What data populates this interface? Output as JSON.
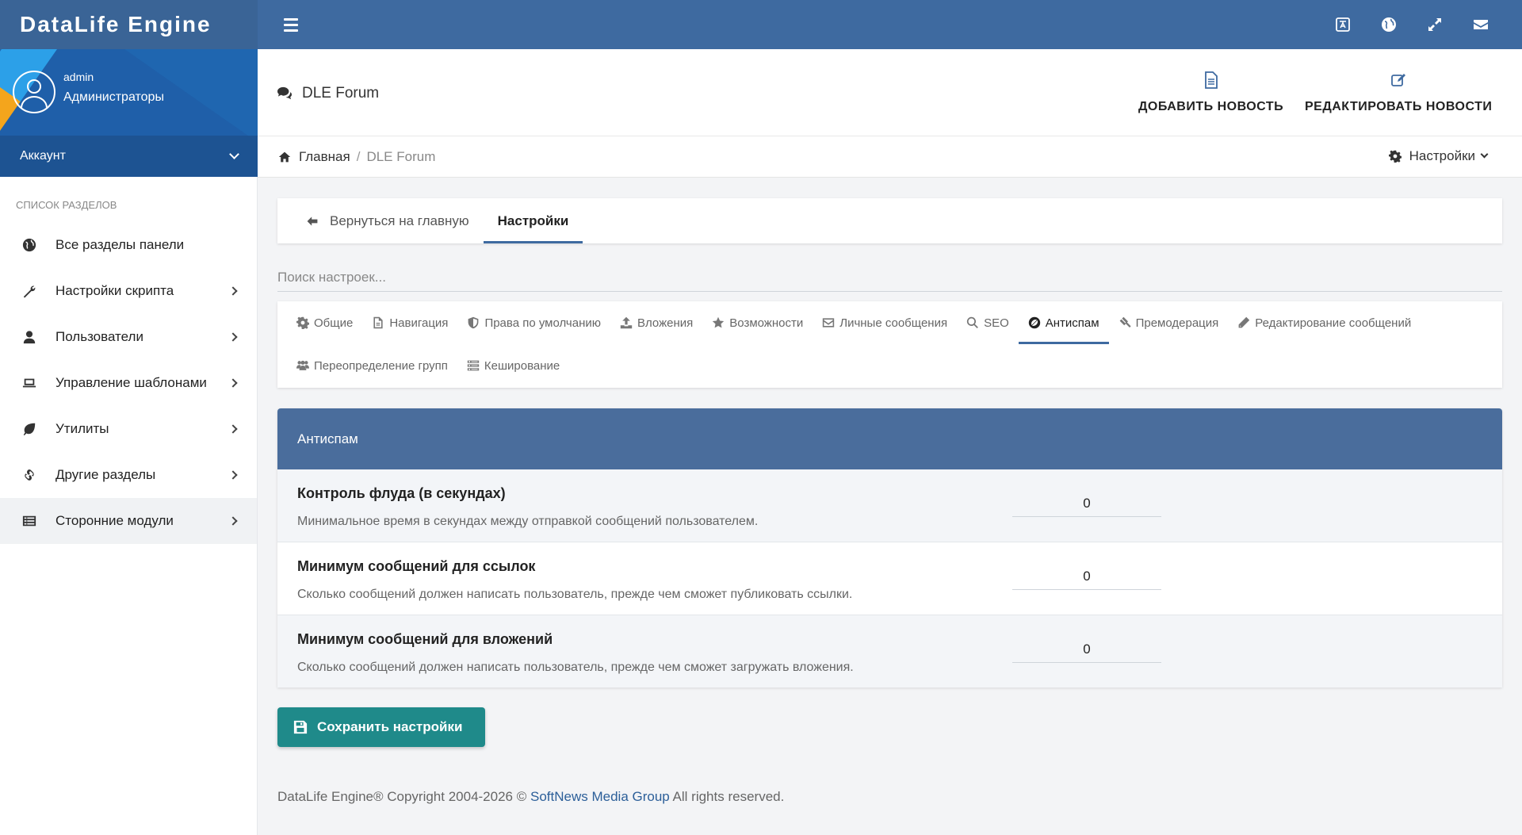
{
  "app": {
    "brand": "DataLife Engine"
  },
  "topbar": {
    "icons": [
      "language-icon",
      "globe-icon",
      "expand-icon",
      "mail-icon"
    ]
  },
  "user": {
    "name": "admin",
    "group": "Администраторы",
    "account_label": "Аккаунт"
  },
  "sidebar": {
    "caption": "Список разделов",
    "items": [
      {
        "label": "Все разделы панели",
        "icon": "globe-icon",
        "has_submenu": false
      },
      {
        "label": "Настройки скрипта",
        "icon": "wrench-icon",
        "has_submenu": true
      },
      {
        "label": "Пользователи",
        "icon": "user-icon",
        "has_submenu": true
      },
      {
        "label": "Управление шаблонами",
        "icon": "laptop-icon",
        "has_submenu": true
      },
      {
        "label": "Утилиты",
        "icon": "leaf-icon",
        "has_submenu": true
      },
      {
        "label": "Другие разделы",
        "icon": "link-icon",
        "has_submenu": true
      },
      {
        "label": "Сторонние модули",
        "icon": "list-icon",
        "has_submenu": true,
        "active": true
      }
    ]
  },
  "header": {
    "title": "DLE Forum",
    "add_news": "ДОБАВИТЬ НОВОСТЬ",
    "edit_news": "РЕДАКТИРОВАТЬ НОВОСТИ"
  },
  "breadcrumb": {
    "home": "Главная",
    "separator": "/",
    "current": "DLE Forum",
    "settings": "Настройки"
  },
  "tabs": {
    "back": "Вернуться на главную",
    "settings": "Настройки"
  },
  "search": {
    "placeholder": "Поиск настроек..."
  },
  "subtabs": {
    "row1": [
      {
        "label": "Общие",
        "icon": "gear-icon"
      },
      {
        "label": "Навигация",
        "icon": "file-icon"
      },
      {
        "label": "Права по умолчанию",
        "icon": "shield-icon"
      },
      {
        "label": "Вложения",
        "icon": "upload-icon"
      },
      {
        "label": "Возможности",
        "icon": "star-icon"
      },
      {
        "label": "Личные сообщения",
        "icon": "envelope-icon"
      },
      {
        "label": "SEO",
        "icon": "search-icon"
      },
      {
        "label": "Антиспам",
        "icon": "ban-icon",
        "active": true
      },
      {
        "label": "Премодерация",
        "icon": "gavel-icon"
      },
      {
        "label": "Редактирование сообщений",
        "icon": "pencil-icon"
      }
    ],
    "row2": [
      {
        "label": "Переопределение групп",
        "icon": "users-icon"
      },
      {
        "label": "Кеширование",
        "icon": "server-icon"
      }
    ]
  },
  "panel": {
    "title": "Антиспам",
    "rows": [
      {
        "title": "Контроль флуда (в секундах)",
        "desc": "Минимальное время в секундах между отправкой сообщений пользователем.",
        "value": "0"
      },
      {
        "title": "Минимум сообщений для ссылок",
        "desc": "Сколько сообщений должен написать пользователь, прежде чем сможет публиковать ссылки.",
        "value": "0"
      },
      {
        "title": "Минимум сообщений для вложений",
        "desc": "Сколько сообщений должен написать пользователь, прежде чем сможет загружать вложения.",
        "value": "0"
      }
    ]
  },
  "save_button": "Сохранить настройки",
  "footer": {
    "prefix": "DataLife Engine® Copyright 2004-2026 ©",
    "link": "SoftNews Media Group",
    "suffix": "All rights reserved."
  },
  "colors": {
    "topbar": "#3e6aa0",
    "panel_head": "#4a6d9c",
    "save_button": "#1f8a8a",
    "link": "#2c5f99"
  }
}
